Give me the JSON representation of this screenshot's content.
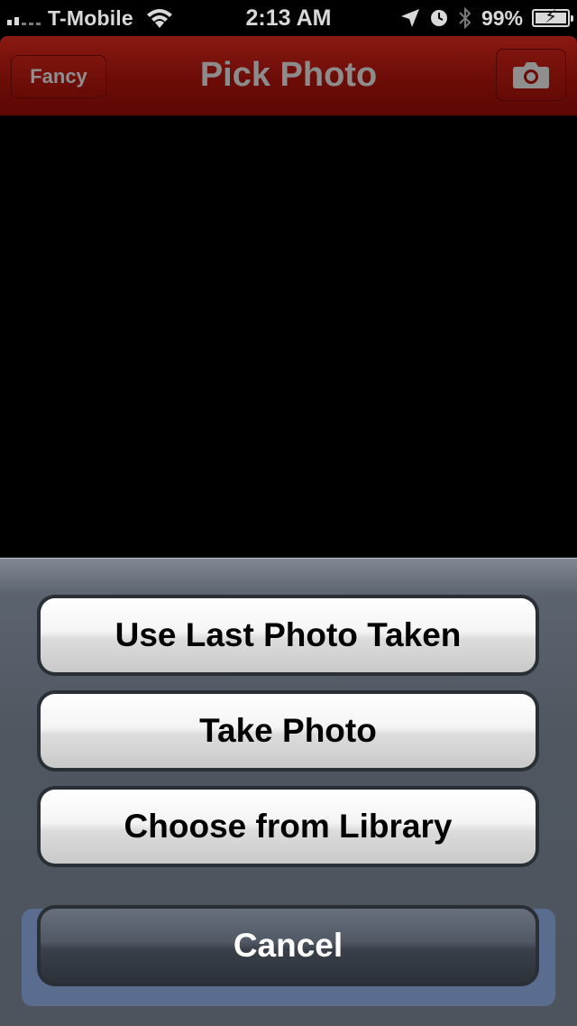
{
  "status_bar": {
    "carrier": "T-Mobile",
    "time": "2:13 AM",
    "battery_percent": "99%",
    "icons": [
      "signal-icon",
      "wifi-icon",
      "location-arrow-icon",
      "alarm-clock-icon",
      "bluetooth-icon",
      "battery-charging-icon"
    ]
  },
  "nav_bar": {
    "title": "Pick Photo",
    "left_button": "Fancy",
    "right_button_icon": "camera-icon",
    "color": "#6c0c07"
  },
  "action_sheet": {
    "options": [
      "Use Last Photo Taken",
      "Take Photo",
      "Choose from Library"
    ],
    "cancel": "Cancel"
  }
}
